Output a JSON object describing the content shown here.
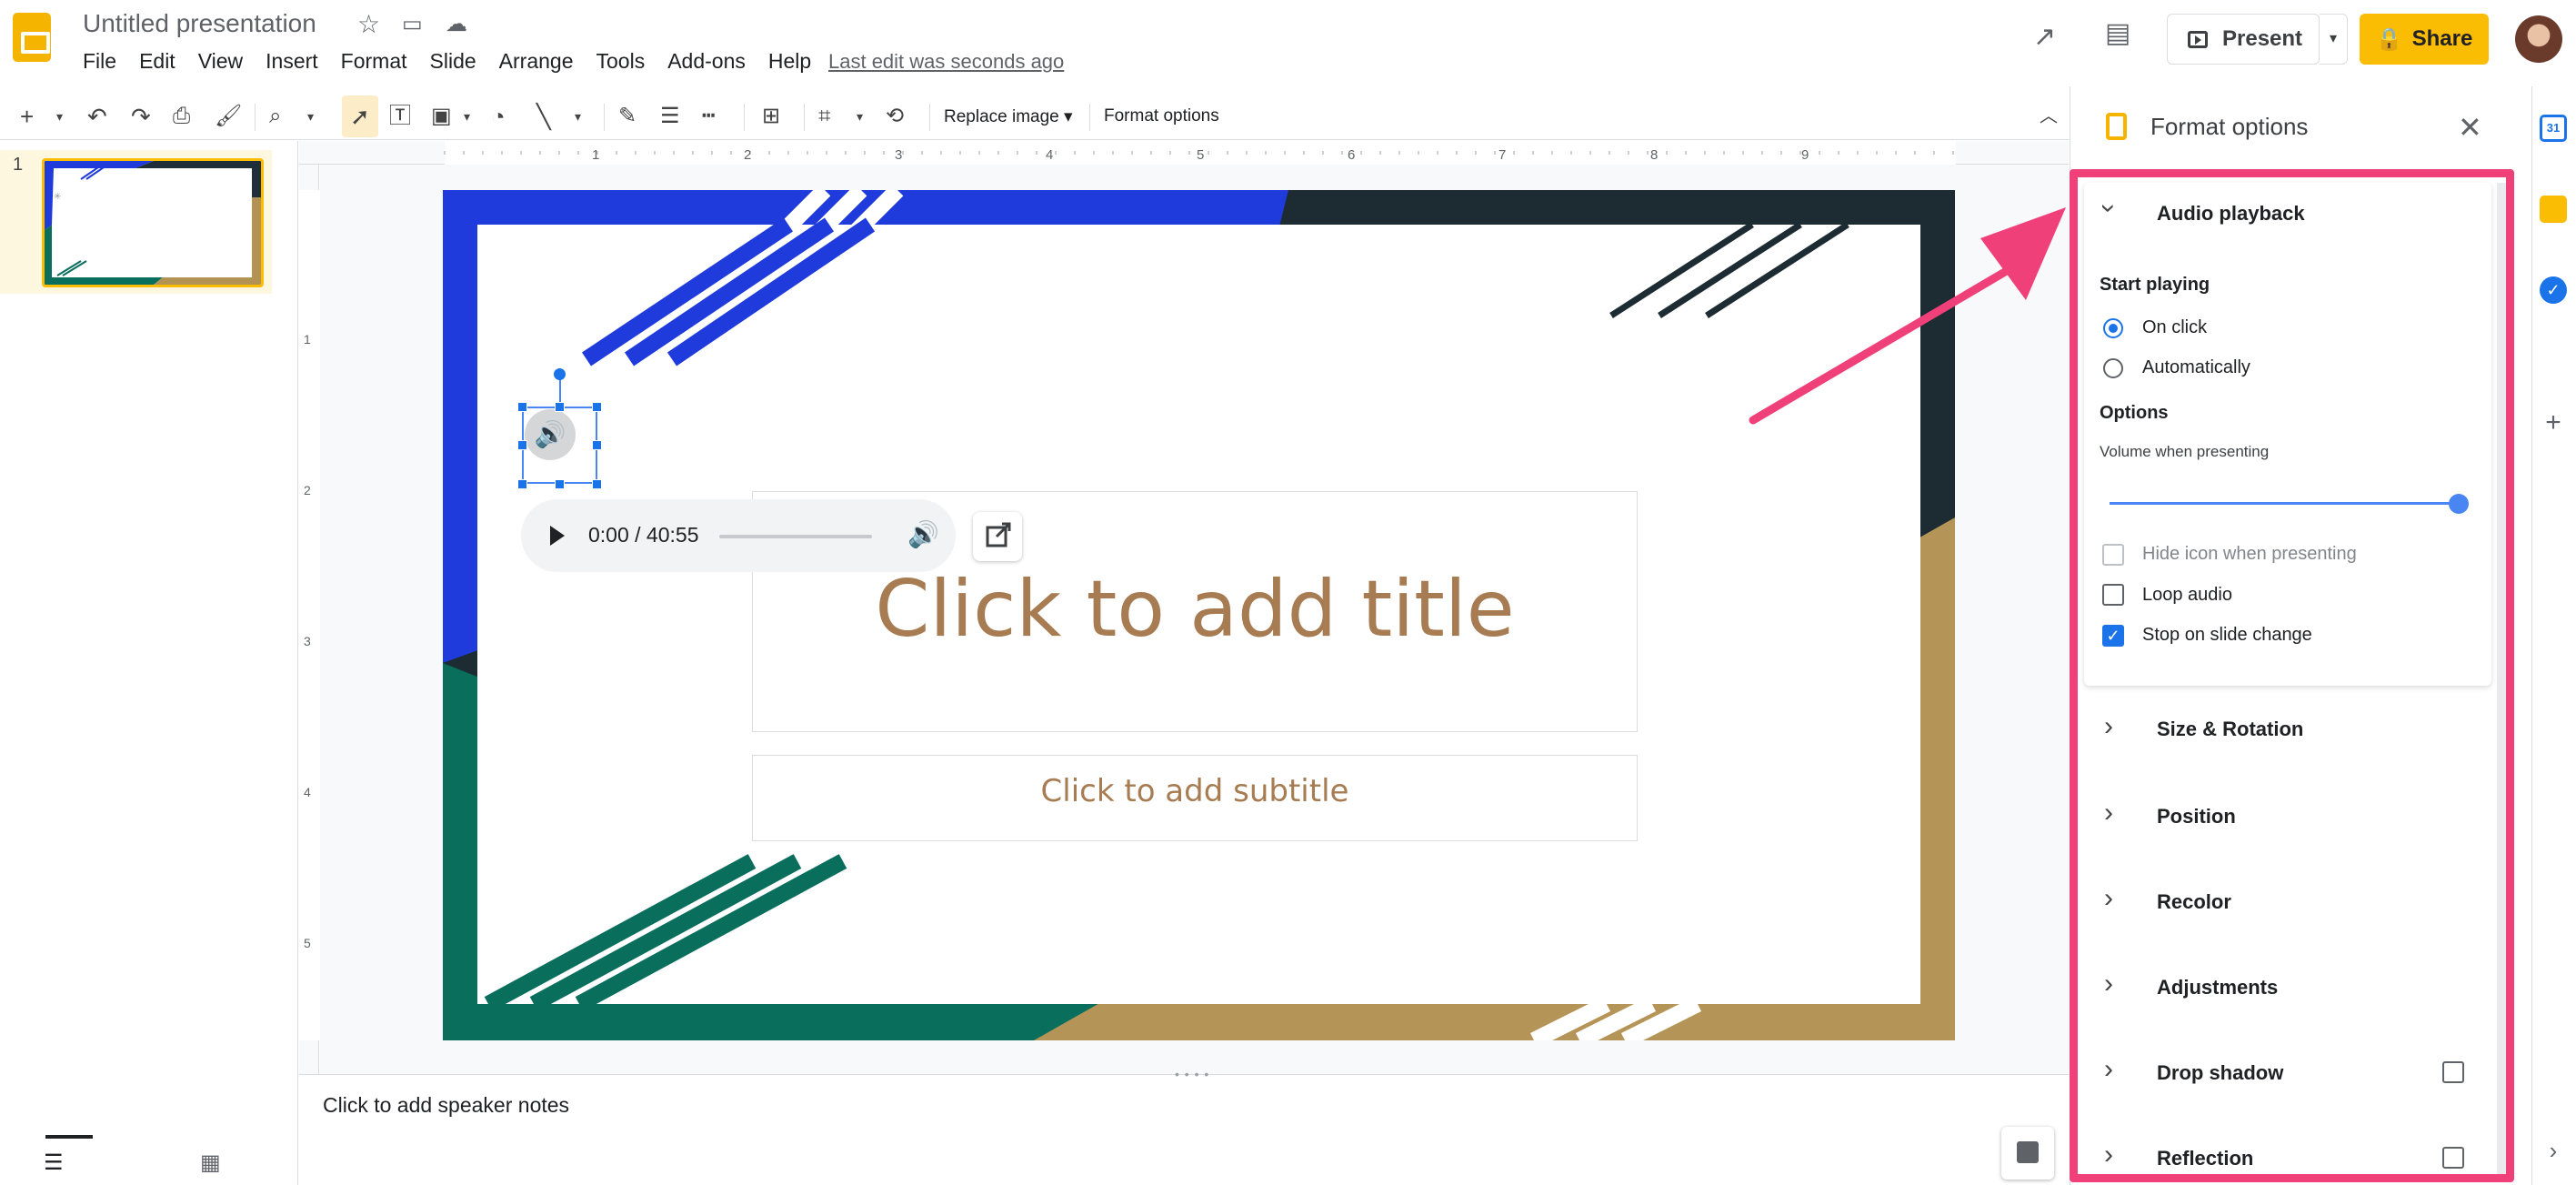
{
  "app": {
    "doc_title": "Untitled presentation",
    "last_edit": "Last edit was seconds ago",
    "menu": [
      "File",
      "Edit",
      "View",
      "Insert",
      "Format",
      "Slide",
      "Arrange",
      "Tools",
      "Add-ons",
      "Help"
    ],
    "present_label": "Present",
    "share_label": "Share"
  },
  "toolbar": {
    "replace_image": "Replace image",
    "format_options": "Format options"
  },
  "filmstrip": {
    "slide_number": "1"
  },
  "rulers": {
    "h_ticks": [
      "1",
      "2",
      "3",
      "4",
      "5",
      "6",
      "7",
      "8",
      "9"
    ],
    "v_ticks": [
      "1",
      "2",
      "3",
      "4",
      "5"
    ]
  },
  "slide": {
    "title_placeholder": "Click to add title",
    "subtitle_placeholder": "Click to add subtitle",
    "media_time": "0:00 / 40:55"
  },
  "notes": {
    "placeholder": "Click to add speaker notes"
  },
  "format_panel": {
    "title": "Format options",
    "audio": {
      "header": "Audio playback",
      "start_playing_label": "Start playing",
      "on_click": "On click",
      "automatically": "Automatically",
      "options_label": "Options",
      "volume_label": "Volume when presenting",
      "volume_level_fraction": 1.0,
      "hide_icon": "Hide icon when presenting",
      "loop_audio": "Loop audio",
      "stop_on_change": "Stop on slide change"
    },
    "sections": [
      "Size & Rotation",
      "Position",
      "Recolor",
      "Adjustments",
      "Drop shadow",
      "Reflection"
    ]
  },
  "colors": {
    "accent": "#1a73e8",
    "highlight": "#f0407a",
    "share": "#fbbc04",
    "placeholder_text": "#a87c52"
  }
}
